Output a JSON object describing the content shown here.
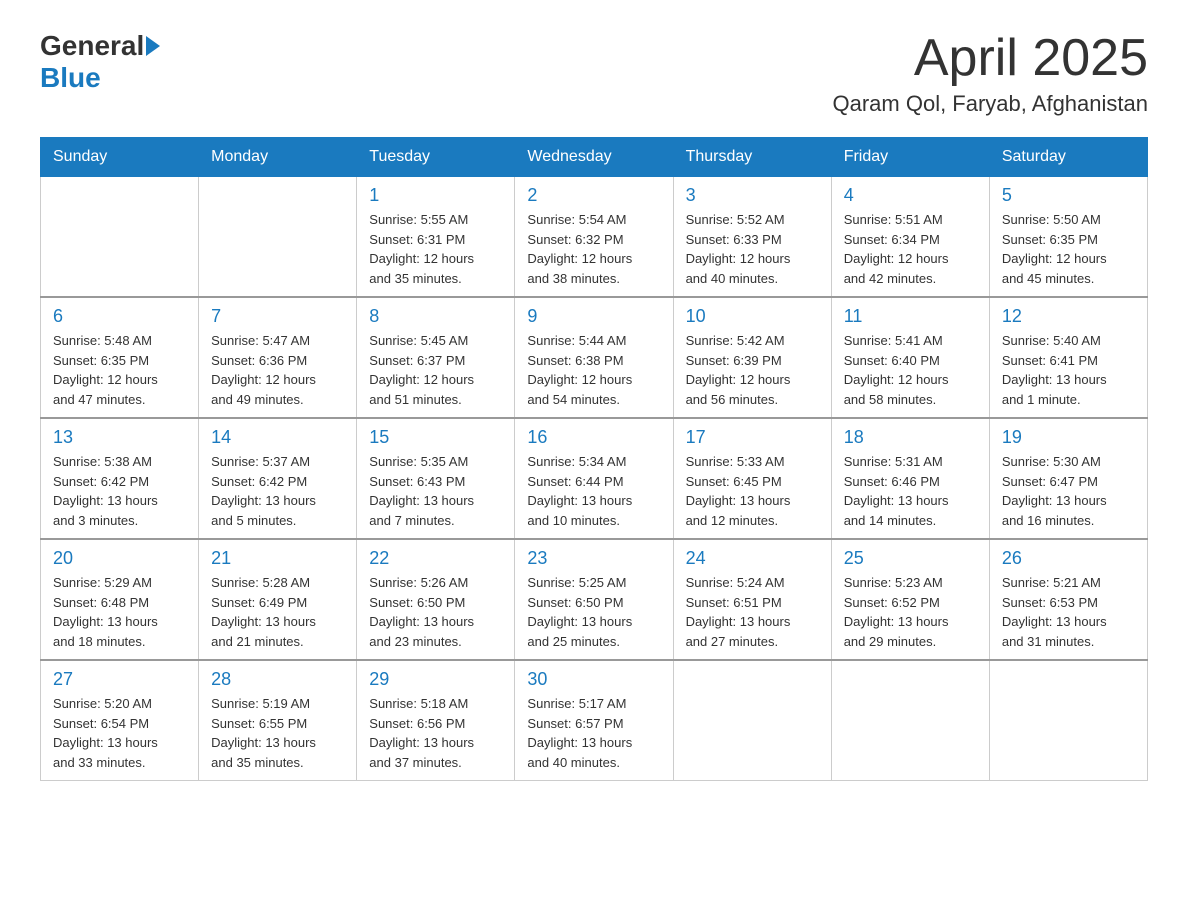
{
  "header": {
    "logo": {
      "general": "General",
      "blue": "Blue"
    },
    "title": "April 2025",
    "location": "Qaram Qol, Faryab, Afghanistan"
  },
  "weekdays": [
    "Sunday",
    "Monday",
    "Tuesday",
    "Wednesday",
    "Thursday",
    "Friday",
    "Saturday"
  ],
  "weeks": [
    [
      {
        "day": "",
        "info": ""
      },
      {
        "day": "",
        "info": ""
      },
      {
        "day": "1",
        "info": "Sunrise: 5:55 AM\nSunset: 6:31 PM\nDaylight: 12 hours\nand 35 minutes."
      },
      {
        "day": "2",
        "info": "Sunrise: 5:54 AM\nSunset: 6:32 PM\nDaylight: 12 hours\nand 38 minutes."
      },
      {
        "day": "3",
        "info": "Sunrise: 5:52 AM\nSunset: 6:33 PM\nDaylight: 12 hours\nand 40 minutes."
      },
      {
        "day": "4",
        "info": "Sunrise: 5:51 AM\nSunset: 6:34 PM\nDaylight: 12 hours\nand 42 minutes."
      },
      {
        "day": "5",
        "info": "Sunrise: 5:50 AM\nSunset: 6:35 PM\nDaylight: 12 hours\nand 45 minutes."
      }
    ],
    [
      {
        "day": "6",
        "info": "Sunrise: 5:48 AM\nSunset: 6:35 PM\nDaylight: 12 hours\nand 47 minutes."
      },
      {
        "day": "7",
        "info": "Sunrise: 5:47 AM\nSunset: 6:36 PM\nDaylight: 12 hours\nand 49 minutes."
      },
      {
        "day": "8",
        "info": "Sunrise: 5:45 AM\nSunset: 6:37 PM\nDaylight: 12 hours\nand 51 minutes."
      },
      {
        "day": "9",
        "info": "Sunrise: 5:44 AM\nSunset: 6:38 PM\nDaylight: 12 hours\nand 54 minutes."
      },
      {
        "day": "10",
        "info": "Sunrise: 5:42 AM\nSunset: 6:39 PM\nDaylight: 12 hours\nand 56 minutes."
      },
      {
        "day": "11",
        "info": "Sunrise: 5:41 AM\nSunset: 6:40 PM\nDaylight: 12 hours\nand 58 minutes."
      },
      {
        "day": "12",
        "info": "Sunrise: 5:40 AM\nSunset: 6:41 PM\nDaylight: 13 hours\nand 1 minute."
      }
    ],
    [
      {
        "day": "13",
        "info": "Sunrise: 5:38 AM\nSunset: 6:42 PM\nDaylight: 13 hours\nand 3 minutes."
      },
      {
        "day": "14",
        "info": "Sunrise: 5:37 AM\nSunset: 6:42 PM\nDaylight: 13 hours\nand 5 minutes."
      },
      {
        "day": "15",
        "info": "Sunrise: 5:35 AM\nSunset: 6:43 PM\nDaylight: 13 hours\nand 7 minutes."
      },
      {
        "day": "16",
        "info": "Sunrise: 5:34 AM\nSunset: 6:44 PM\nDaylight: 13 hours\nand 10 minutes."
      },
      {
        "day": "17",
        "info": "Sunrise: 5:33 AM\nSunset: 6:45 PM\nDaylight: 13 hours\nand 12 minutes."
      },
      {
        "day": "18",
        "info": "Sunrise: 5:31 AM\nSunset: 6:46 PM\nDaylight: 13 hours\nand 14 minutes."
      },
      {
        "day": "19",
        "info": "Sunrise: 5:30 AM\nSunset: 6:47 PM\nDaylight: 13 hours\nand 16 minutes."
      }
    ],
    [
      {
        "day": "20",
        "info": "Sunrise: 5:29 AM\nSunset: 6:48 PM\nDaylight: 13 hours\nand 18 minutes."
      },
      {
        "day": "21",
        "info": "Sunrise: 5:28 AM\nSunset: 6:49 PM\nDaylight: 13 hours\nand 21 minutes."
      },
      {
        "day": "22",
        "info": "Sunrise: 5:26 AM\nSunset: 6:50 PM\nDaylight: 13 hours\nand 23 minutes."
      },
      {
        "day": "23",
        "info": "Sunrise: 5:25 AM\nSunset: 6:50 PM\nDaylight: 13 hours\nand 25 minutes."
      },
      {
        "day": "24",
        "info": "Sunrise: 5:24 AM\nSunset: 6:51 PM\nDaylight: 13 hours\nand 27 minutes."
      },
      {
        "day": "25",
        "info": "Sunrise: 5:23 AM\nSunset: 6:52 PM\nDaylight: 13 hours\nand 29 minutes."
      },
      {
        "day": "26",
        "info": "Sunrise: 5:21 AM\nSunset: 6:53 PM\nDaylight: 13 hours\nand 31 minutes."
      }
    ],
    [
      {
        "day": "27",
        "info": "Sunrise: 5:20 AM\nSunset: 6:54 PM\nDaylight: 13 hours\nand 33 minutes."
      },
      {
        "day": "28",
        "info": "Sunrise: 5:19 AM\nSunset: 6:55 PM\nDaylight: 13 hours\nand 35 minutes."
      },
      {
        "day": "29",
        "info": "Sunrise: 5:18 AM\nSunset: 6:56 PM\nDaylight: 13 hours\nand 37 minutes."
      },
      {
        "day": "30",
        "info": "Sunrise: 5:17 AM\nSunset: 6:57 PM\nDaylight: 13 hours\nand 40 minutes."
      },
      {
        "day": "",
        "info": ""
      },
      {
        "day": "",
        "info": ""
      },
      {
        "day": "",
        "info": ""
      }
    ]
  ]
}
